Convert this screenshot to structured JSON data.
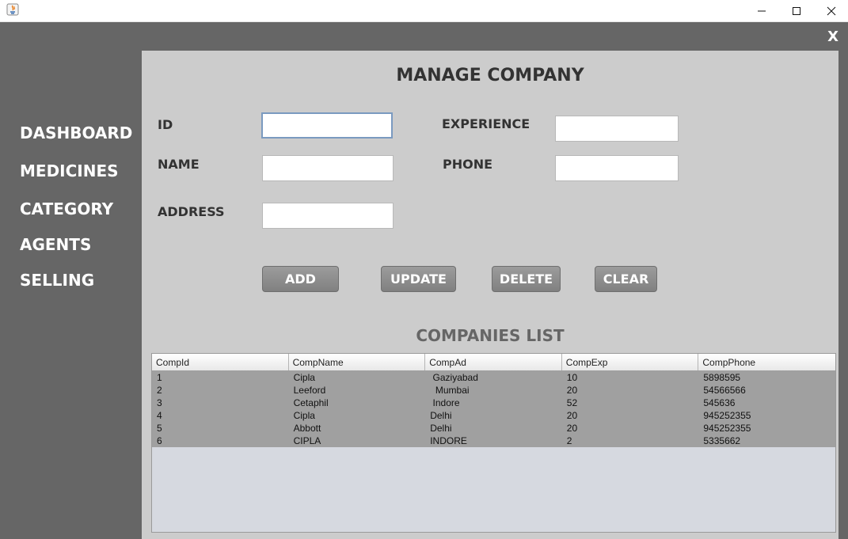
{
  "titlebar": {
    "icons": [
      "java-app-icon",
      "minimize-icon",
      "maximize-icon",
      "close-icon"
    ]
  },
  "app": {
    "close_label": "X"
  },
  "sidebar": {
    "items": [
      {
        "label": "DASHBOARD"
      },
      {
        "label": "MEDICINES"
      },
      {
        "label": "CATEGORY"
      },
      {
        "label": "AGENTS"
      },
      {
        "label": "SELLING"
      }
    ]
  },
  "form": {
    "title": "MANAGE COMPANY",
    "id_label": "ID",
    "id_value": "",
    "name_label": "NAME",
    "name_value": "",
    "address_label": "ADDRESS",
    "address_value": "",
    "experience_label": "EXPERIENCE",
    "experience_value": "",
    "phone_label": "PHONE",
    "phone_value": ""
  },
  "buttons": {
    "add": "ADD",
    "update": "UPDATE",
    "delete": "DELETE",
    "clear": "CLEAR"
  },
  "table": {
    "title": "COMPANIES LIST",
    "columns": [
      "CompId",
      "CompName",
      "CompAd",
      "CompExp",
      "CompPhone"
    ],
    "rows": [
      [
        "1",
        "Cipla",
        " Gaziyabad",
        "10",
        "5898595"
      ],
      [
        "2",
        "Leeford",
        "  Mumbai",
        "20",
        "54566566"
      ],
      [
        "3",
        "Cetaphil",
        " Indore",
        "52",
        "545636"
      ],
      [
        "4",
        "Cipla",
        "Delhi",
        "20",
        "945252355"
      ],
      [
        "5",
        "Abbott",
        "Delhi",
        "20",
        "945252355"
      ],
      [
        "6",
        "CIPLA",
        "INDORE",
        "2",
        "5335662"
      ]
    ]
  },
  "colors": {
    "sidebar_bg": "#666666",
    "panel_bg": "#cccccc",
    "button_bg": "#8a8a8a",
    "table_row_bg": "#a0a0a0",
    "table_empty_bg": "#d6d9e0"
  }
}
